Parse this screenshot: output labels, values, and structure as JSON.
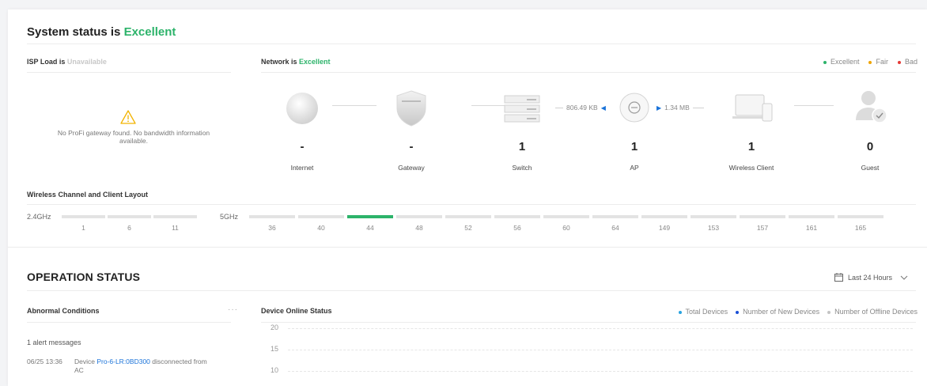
{
  "system": {
    "title_prefix": "System status is ",
    "status": "Excellent"
  },
  "isp": {
    "label_prefix": "ISP Load is ",
    "status": "Unavailable",
    "message_line1": "No ProFi gateway found. No bandwidth information",
    "message_line2": "available."
  },
  "network": {
    "label_prefix": "Network is ",
    "status": "Excellent",
    "legend": [
      {
        "label": "Excellent",
        "color": "#2cb36a"
      },
      {
        "label": "Fair",
        "color": "#f0a500"
      },
      {
        "label": "Bad",
        "color": "#e53935"
      }
    ],
    "devices": [
      {
        "icon": "internet-globe-icon",
        "count": "-",
        "label": "Internet"
      },
      {
        "icon": "gateway-shield-icon",
        "count": "-",
        "label": "Gateway"
      },
      {
        "icon": "switch-icon",
        "count": "1",
        "label": "Switch"
      },
      {
        "icon": "access-point-icon",
        "count": "1",
        "label": "AP"
      },
      {
        "icon": "wireless-client-icon",
        "count": "1",
        "label": "Wireless Client"
      },
      {
        "icon": "guest-user-icon",
        "count": "0",
        "label": "Guest"
      }
    ],
    "traffic_down": "806.49 KB",
    "traffic_up": "1.34 MB"
  },
  "channels": {
    "title": "Wireless Channel and Client Layout",
    "band24": "2.4GHz",
    "band5": "5GHz",
    "list24": [
      "1",
      "6",
      "11"
    ],
    "list5": [
      "36",
      "40",
      "44",
      "48",
      "52",
      "56",
      "60",
      "64",
      "149",
      "153",
      "157",
      "161",
      "165"
    ],
    "active5": "44"
  },
  "operation": {
    "title": "OPERATION STATUS",
    "range": "Last 24 Hours",
    "abnormal_title": "Abnormal Conditions",
    "more": "···",
    "alert_count": "1 alert messages",
    "alert_time": "06/25 13:36",
    "alert_prefix": "Device ",
    "alert_device": "Pro-6-LR:0BD300",
    "alert_suffix": " disconnected from",
    "alert_suffix2": "AC",
    "online_title": "Device Online Status",
    "legend": [
      {
        "label": "Total Devices",
        "color": "#29a3e0"
      },
      {
        "label": "Number of New Devices",
        "color": "#1a4fd6"
      },
      {
        "label": "Number of Offline Devices",
        "color": "#c4c4c4"
      }
    ],
    "y_ticks": [
      "20",
      "15",
      "10"
    ]
  },
  "colors": {
    "good": "#2cb36a",
    "link": "#1a73d9"
  }
}
